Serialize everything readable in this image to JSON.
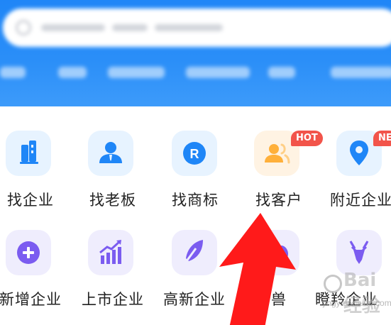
{
  "colors": {
    "header_blue": "#2a8ef8",
    "icon_blue": "#1f86f7",
    "icon_bg_blue": "#e7f3ff",
    "icon_purple": "#7b5cf0",
    "icon_bg_purple": "#efedfd",
    "icon_orange": "#ffb03a",
    "icon_bg_orange": "#fff3e3",
    "badge_red": "#f2544a",
    "arrow_red": "#ff1a1a"
  },
  "grid": {
    "row1": [
      {
        "label": "找企业",
        "icon": "building-icon"
      },
      {
        "label": "找老板",
        "icon": "person-tie-icon"
      },
      {
        "label": "找商标",
        "icon": "registered-trademark-icon"
      },
      {
        "label": "找客户",
        "icon": "customers-icon",
        "badge": "HOT"
      },
      {
        "label": "附近企业",
        "icon": "location-pin-icon",
        "badge": "NE"
      }
    ],
    "row2": [
      {
        "label": "新增企业",
        "icon": "plus-circle-icon"
      },
      {
        "label": "上市企业",
        "icon": "growth-chart-icon"
      },
      {
        "label": "高新企业",
        "icon": "feather-icon"
      },
      {
        "label": "独角兽",
        "icon": "unicorn-icon"
      },
      {
        "label": "瞪羚企业",
        "icon": "gazelle-icon"
      }
    ]
  },
  "overlay": {
    "arrow": "red-up-arrow-annotation"
  },
  "watermark": {
    "text": "Bai经验",
    "url": "jingyan.baidu.com"
  }
}
